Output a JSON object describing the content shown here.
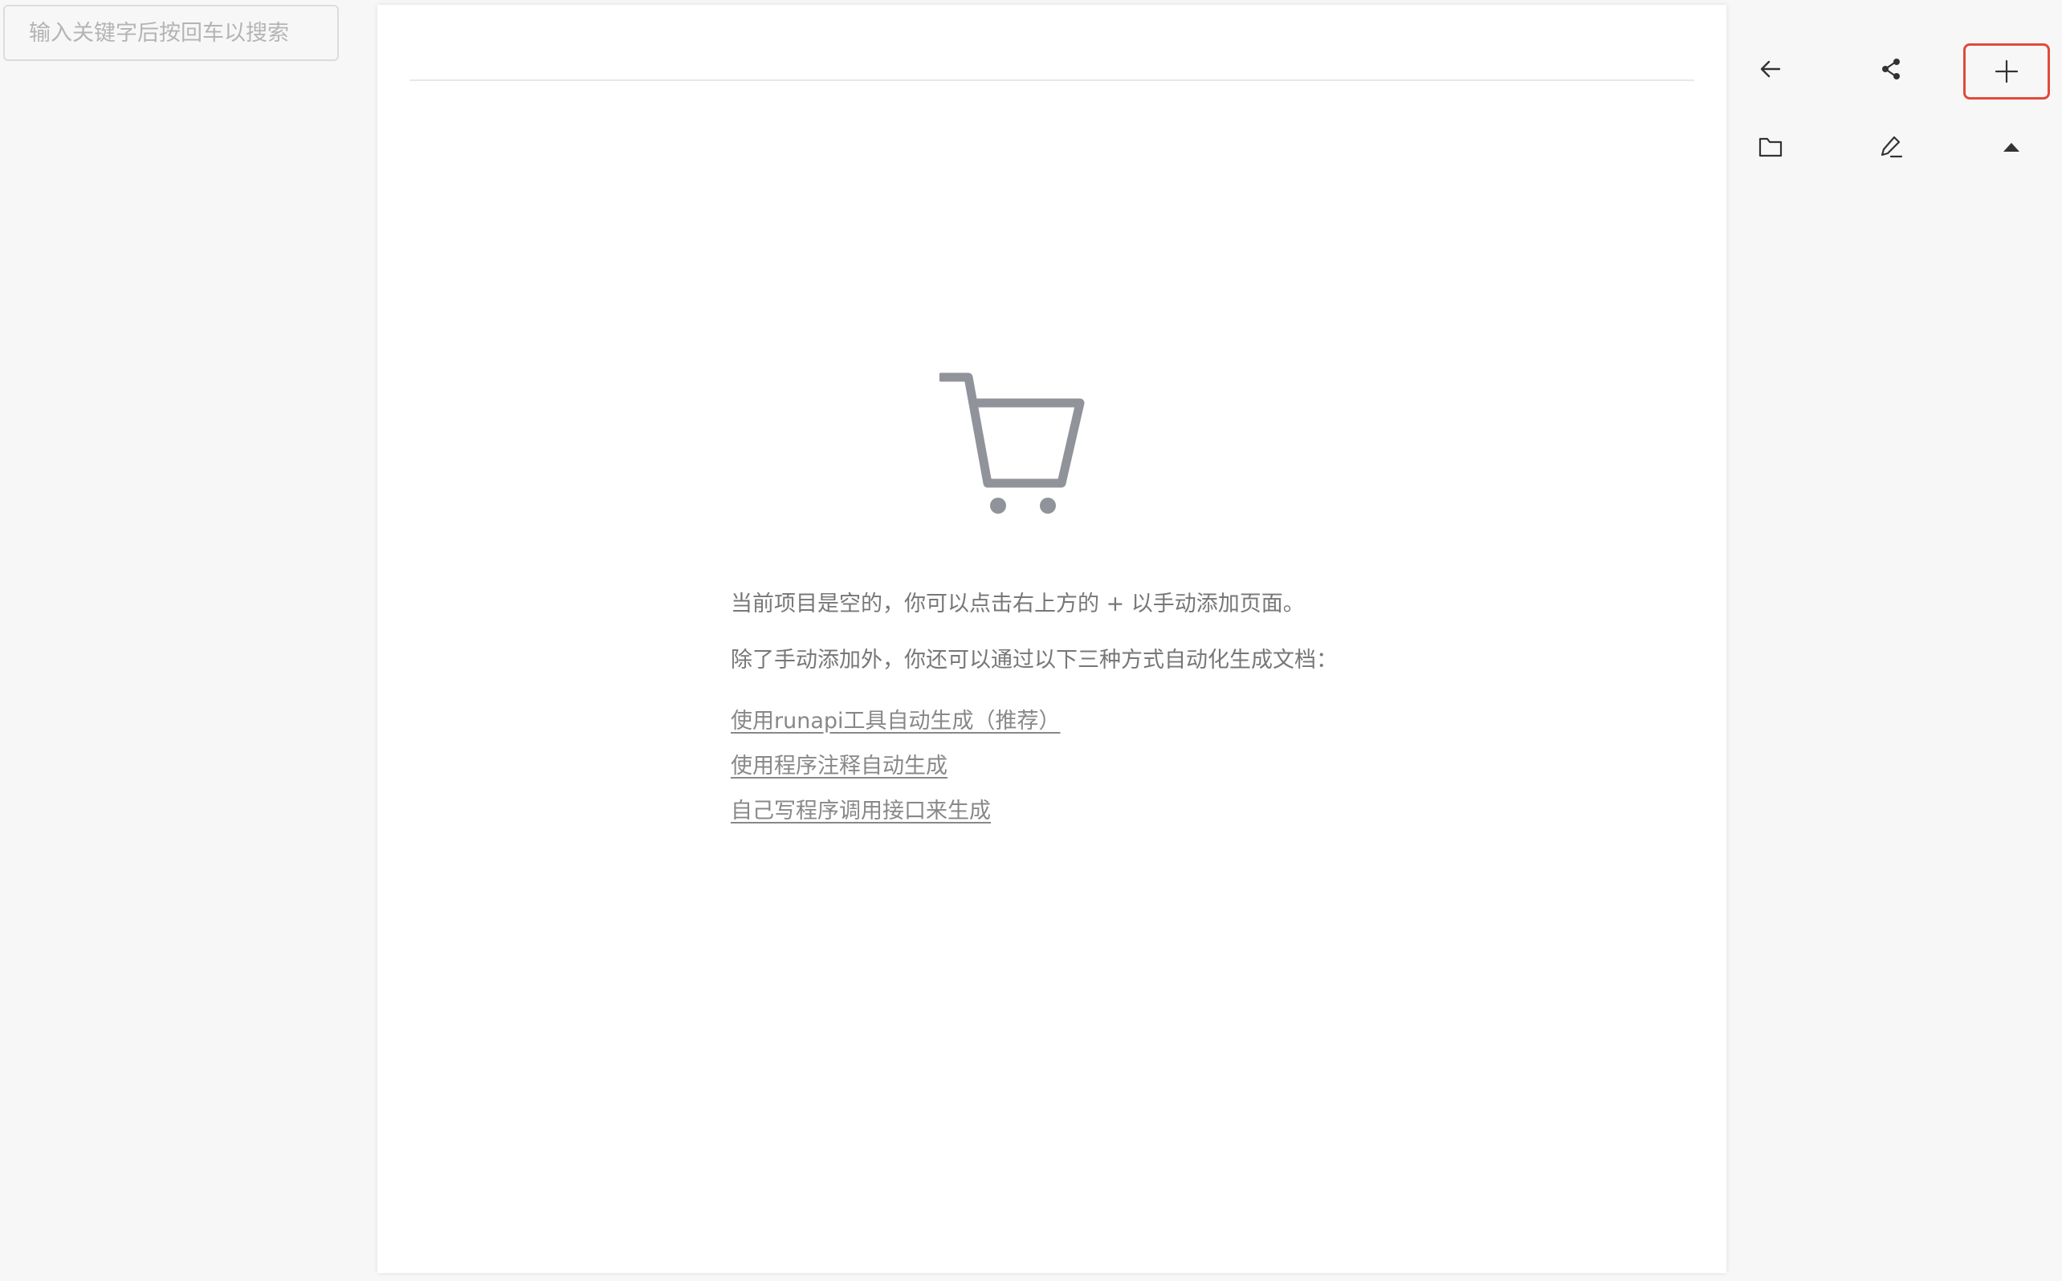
{
  "search": {
    "placeholder": "输入关键字后按回车以搜索",
    "value": ""
  },
  "empty_state": {
    "icon": "shopping-cart-icon",
    "line1": "当前项目是空的，你可以点击右上方的 + 以手动添加页面。",
    "line2": "除了手动添加外，你还可以通过以下三种方式自动化生成文档：",
    "links": [
      "使用runapi工具自动生成（推荐）",
      "使用程序注释自动生成",
      "自己写程序调用接口来生成"
    ]
  },
  "toolbar": {
    "icons": [
      "back-arrow-icon",
      "share-icon",
      "plus-icon",
      "folder-icon",
      "edit-icon",
      "caret-up-icon"
    ],
    "highlight_color": "#e24a3b"
  },
  "colors": {
    "background": "#f7f7f7",
    "panel": "#ffffff",
    "text_muted": "#777777",
    "icon": "#333333",
    "illustration": "#909399"
  }
}
